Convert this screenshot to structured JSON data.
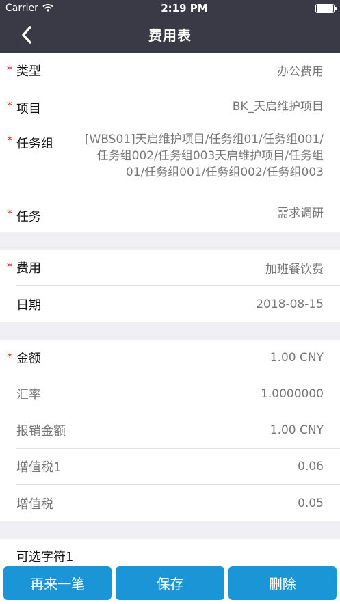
{
  "status": {
    "carrier": "Carrier",
    "time": "2:19 PM"
  },
  "nav": {
    "title": "费用表"
  },
  "group1": {
    "type": {
      "label": "类型",
      "value": "办公费用"
    },
    "project": {
      "label": "项目",
      "value": "BK_天启维护项目"
    },
    "task_group": {
      "label": "任务组",
      "value": "[WBS01]天启维护项目/任务组01/任务组001/任务组002/任务组003天启维护项目/任务组01/任务组001/任务组002/任务组003"
    },
    "task": {
      "label": "任务",
      "value": "需求调研"
    }
  },
  "group2": {
    "expense": {
      "label": "费用",
      "value": "加班餐饮费"
    },
    "date": {
      "label": "日期",
      "value": "2018-08-15"
    }
  },
  "group3": {
    "amount": {
      "label": "金额",
      "value": "1.00  CNY"
    },
    "rate": {
      "label": "汇率",
      "value": "1.0000000"
    },
    "reimburse": {
      "label": "报销金额",
      "value": "1.00  CNY"
    },
    "vat1": {
      "label": "增值税1",
      "value": "0.06"
    },
    "vat": {
      "label": "增值税",
      "value": "0.05"
    }
  },
  "group4": {
    "optional1": {
      "label": "可选字符1"
    }
  },
  "buttons": {
    "again": "再来一笔",
    "save": "保存",
    "delete": "删除"
  },
  "colors": {
    "nav_bg": "#3a3a47",
    "button": "#1a95d6",
    "required": "#e02020"
  }
}
